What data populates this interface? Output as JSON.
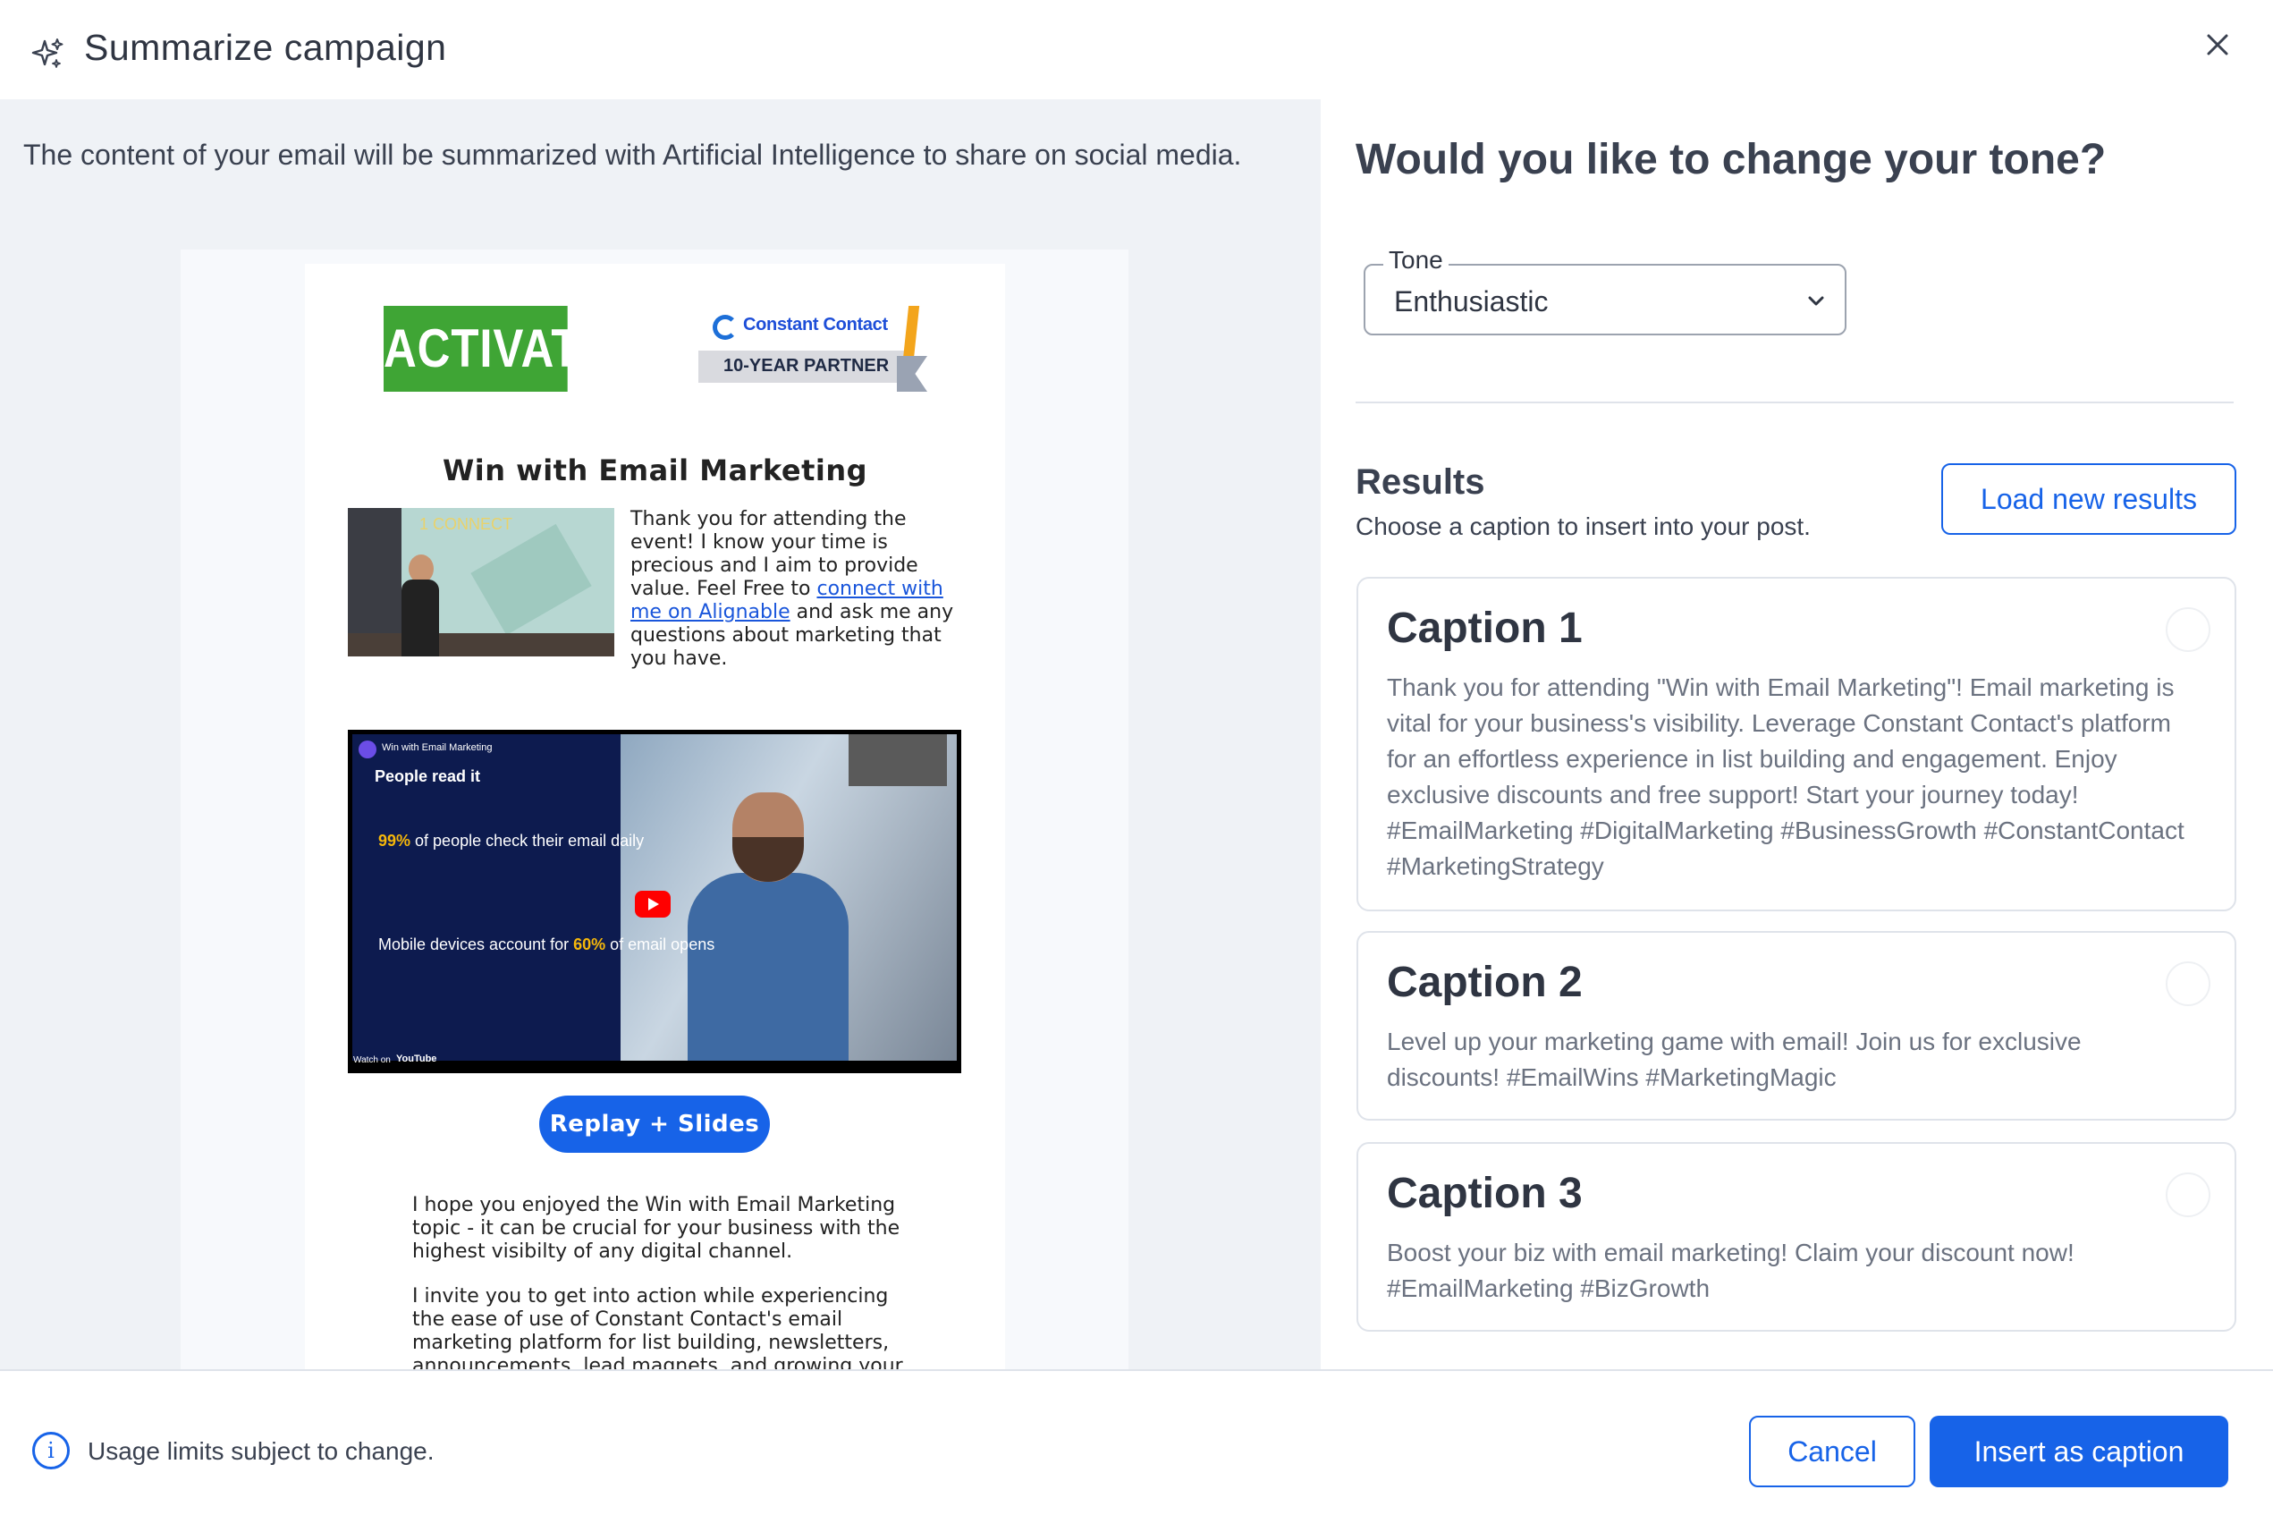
{
  "header": {
    "title": "Summarize campaign",
    "icon": "sparkle-icon",
    "close_icon": "close-icon"
  },
  "left": {
    "intro": "The content of your email will be summarized with Artificial Intelligence to share on social media.",
    "email": {
      "logo_left": "ACTIVATE",
      "logo_right_name": "Constant Contact",
      "logo_right_badge": "10-YEAR PARTNER",
      "title": "Win with Email Marketing",
      "photo_slide_title": "1 CONNECT",
      "body_before_link": "Thank you for attending the event! I know your time is precious and I aim to provide value. Feel Free to ",
      "body_link": "connect with me on Alignable",
      "body_after_link": " and ask me any questions about marketing that you have.",
      "video": {
        "channel": "Win with Email Marketing",
        "heading": "People read it",
        "stat1_value": "99%",
        "stat1_text": " of people check their email daily",
        "stat2_text": "Mobile devices account for ",
        "stat2_value": "60%",
        "stat2_text2": " of email opens",
        "watch_on": "Watch on",
        "youtube": "YouTube"
      },
      "replay_button": "Replay + Slides",
      "para1": "I hope you enjoyed the Win with Email Marketing topic - it can be crucial for your business with the highest visibilty of any digital channel.",
      "para2": "I invite you to get into action while experiencing the ease of use of Constant Contact's email marketing platform for list building, newsletters, announcements, lead magnets, and growing your"
    }
  },
  "right": {
    "question": "Would you like to change your tone?",
    "tone": {
      "label": "Tone",
      "value": "Enthusiastic"
    },
    "results": {
      "heading": "Results",
      "subtext": "Choose a caption to insert into your post.",
      "load_button": "Load new results"
    },
    "captions": [
      {
        "title": "Caption 1",
        "text": "Thank you for attending \"Win with Email Marketing\"! Email marketing is vital for your business's visibility. Leverage Constant Contact's platform for an effortless experience in list building and engagement. Enjoy exclusive discounts and free support! Start your journey today! #EmailMarketing #DigitalMarketing #BusinessGrowth #ConstantContact #MarketingStrategy"
      },
      {
        "title": "Caption 2",
        "text": "Level up your marketing game with email! Join us for exclusive discounts! #EmailWins #MarketingMagic"
      },
      {
        "title": "Caption 3",
        "text": "Boost your biz with email marketing! Claim your discount now! #EmailMarketing #BizGrowth"
      }
    ]
  },
  "footer": {
    "usage_note": "Usage limits subject to change.",
    "cancel": "Cancel",
    "insert": "Insert as caption"
  },
  "colors": {
    "accent": "#1763e8",
    "left_bg": "#eff2f6",
    "text": "#2f3542",
    "muted": "#6b7280"
  }
}
